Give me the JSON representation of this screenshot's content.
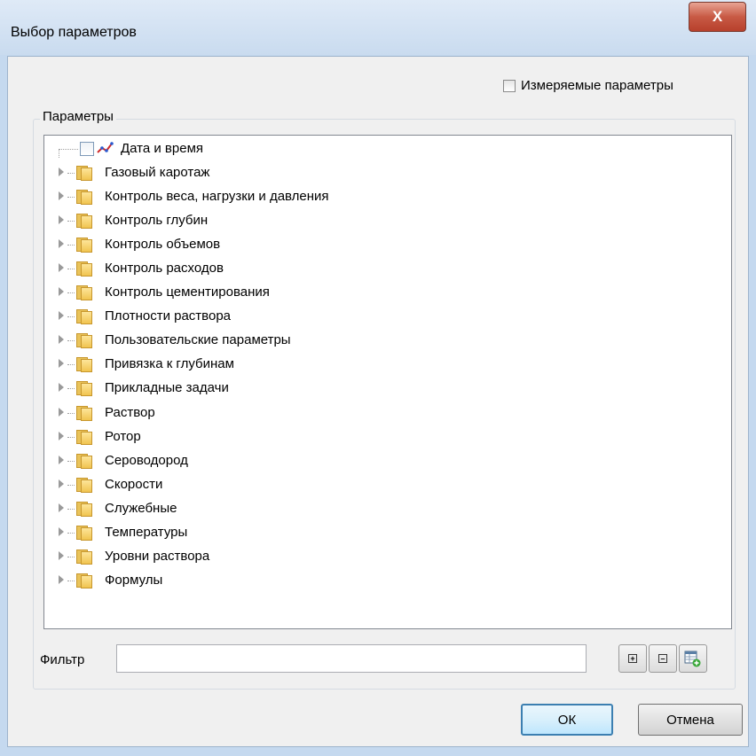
{
  "window": {
    "title": "Выбор параметров",
    "close_label": "X"
  },
  "measured": {
    "label": "Измеряемые параметры",
    "checked": false
  },
  "group": {
    "legend": "Параметры"
  },
  "tree": {
    "first_item": {
      "label": "Дата и время",
      "icon": "chart-line-icon",
      "checked": false
    },
    "folders": [
      "Газовый каротаж",
      "Контроль веса, нагрузки и давления",
      "Контроль глубин",
      "Контроль объемов",
      "Контроль расходов",
      "Контроль цементирования",
      "Плотности раствора",
      "Пользовательские параметры",
      "Привязка к глубинам",
      "Прикладные задачи",
      "Раствор",
      "Ротор",
      "Сероводород",
      "Скорости",
      "Служебные",
      "Температуры",
      "Уровни раствора",
      "Формулы"
    ]
  },
  "filter": {
    "label": "Фильтр",
    "value": ""
  },
  "tools": {
    "expand_icon": "plus-box-icon",
    "collapse_icon": "minus-box-icon",
    "table_add_icon": "table-add-icon"
  },
  "buttons": {
    "ok": "ОК",
    "cancel": "Отмена"
  }
}
